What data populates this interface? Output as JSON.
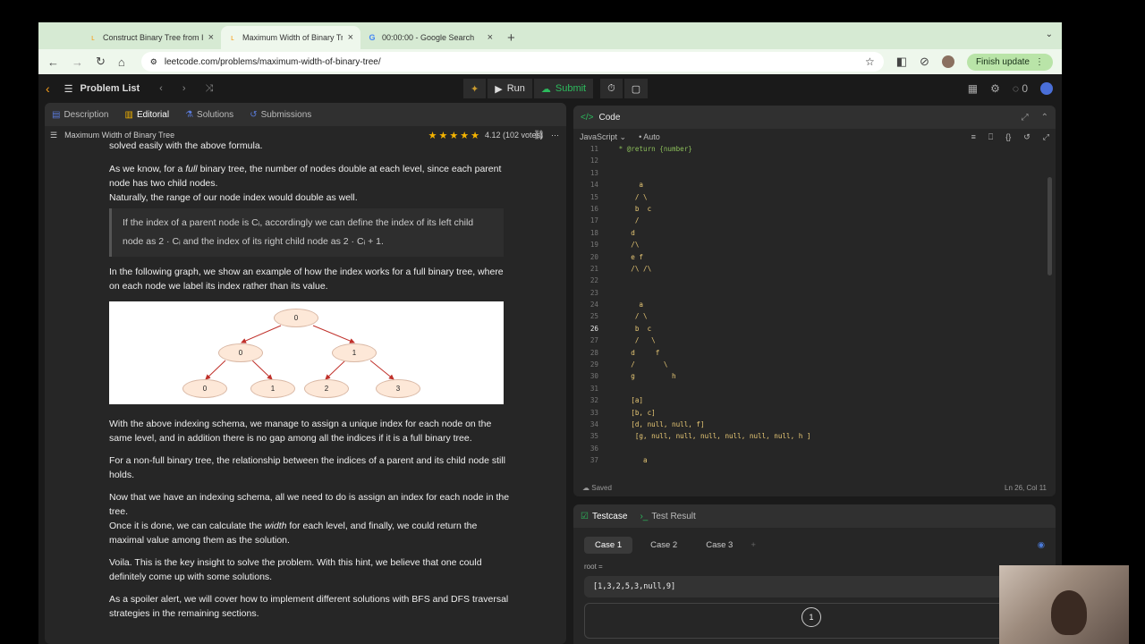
{
  "tabs": [
    {
      "title": "Construct Binary Tree from In",
      "icon": "leetcode-icon",
      "active": false
    },
    {
      "title": "Maximum Width of Binary Tre",
      "icon": "leetcode-icon",
      "active": true
    },
    {
      "title": "00:00:00 - Google Search",
      "icon": "google-icon",
      "active": false
    }
  ],
  "url": "leetcode.com/problems/maximum-width-of-binary-tree/",
  "finish_update": "Finish update",
  "nav": {
    "problem_list": "Problem List",
    "run": "Run",
    "submit": "Submit",
    "notif_count": "0"
  },
  "left": {
    "tabs": [
      "Description",
      "Editorial",
      "Solutions",
      "Submissions"
    ],
    "title": "Maximum Width of Binary Tree",
    "rating": "4.12 (102 votes)",
    "p0": "solved easily with the above formula.",
    "p1a": "As we know, for a ",
    "p1b": "full",
    "p1c": " binary tree, the number of nodes double at each level, since each parent node has two child nodes.",
    "p1d": "Naturally, the range of our node index would double as well.",
    "q1": "If the index of a parent node is Cᵢ, accordingly we can define the index of its left child",
    "q2": "node as 2 · Cᵢ and the index of its right child node as 2 · Cᵢ + 1.",
    "p2": "In the following graph, we show an example of how the index works for a full binary tree, where on each node we label its index rather than its value.",
    "graph_nodes": [
      "0",
      "0",
      "1",
      "0",
      "1",
      "2",
      "3"
    ],
    "p3": "With the above indexing schema, we manage to assign a unique index for each node on the same level, and in addition there is no gap among all the indices if it is a full binary tree.",
    "p4": "For a non-full binary tree, the relationship between the indices of a parent and its child node still holds.",
    "p5": "Now that we have an indexing schema, all we need to do is assign an index for each node in the tree.",
    "p6a": "Once it is done, we can calculate the ",
    "p6b": "width",
    "p6c": " for each level, and finally, we could return the maximal value among them as the solution.",
    "p7": "Voila. This is the key insight to solve the problem. With this hint, we believe that one could definitely come up with some solutions.",
    "p8": "As a spoiler alert, we will cover how to implement different solutions with BFS and DFS traversal strategies in the remaining sections."
  },
  "editor": {
    "title": "Code",
    "language": "JavaScript",
    "mode": "Auto",
    "status": "Saved",
    "cursor": "Ln 26, Col 11",
    "lines": [
      {
        "n": "11",
        "t": " * @return {number}"
      },
      {
        "n": "12",
        "t": ""
      },
      {
        "n": "13",
        "t": ""
      },
      {
        "n": "14",
        "t": "      a"
      },
      {
        "n": "15",
        "t": "     / \\"
      },
      {
        "n": "16",
        "t": "     b  c"
      },
      {
        "n": "17",
        "t": "     /"
      },
      {
        "n": "18",
        "t": "    d"
      },
      {
        "n": "19",
        "t": "    /\\"
      },
      {
        "n": "20",
        "t": "    e f"
      },
      {
        "n": "21",
        "t": "    /\\ /\\"
      },
      {
        "n": "22",
        "t": ""
      },
      {
        "n": "23",
        "t": ""
      },
      {
        "n": "24",
        "t": "      a"
      },
      {
        "n": "25",
        "t": "     / \\"
      },
      {
        "n": "26",
        "t": "     b  c"
      },
      {
        "n": "27",
        "t": "     /   \\"
      },
      {
        "n": "28",
        "t": "    d     f"
      },
      {
        "n": "29",
        "t": "    /       \\"
      },
      {
        "n": "30",
        "t": "    g         h"
      },
      {
        "n": "31",
        "t": ""
      },
      {
        "n": "32",
        "t": "    [a]"
      },
      {
        "n": "33",
        "t": "    [b, c]"
      },
      {
        "n": "34",
        "t": "    [d, null, null, f]"
      },
      {
        "n": "35",
        "t": "     [g, null, null, null, null, null, null, h ]"
      },
      {
        "n": "36",
        "t": ""
      },
      {
        "n": "37",
        "t": "       a"
      }
    ]
  },
  "testcase": {
    "tabs": [
      "Testcase",
      "Test Result"
    ],
    "cases": [
      "Case 1",
      "Case 2",
      "Case 3"
    ],
    "root_label": "root =",
    "root_value": "[1,3,2,5,3,null,9]",
    "preview_node": "1"
  }
}
